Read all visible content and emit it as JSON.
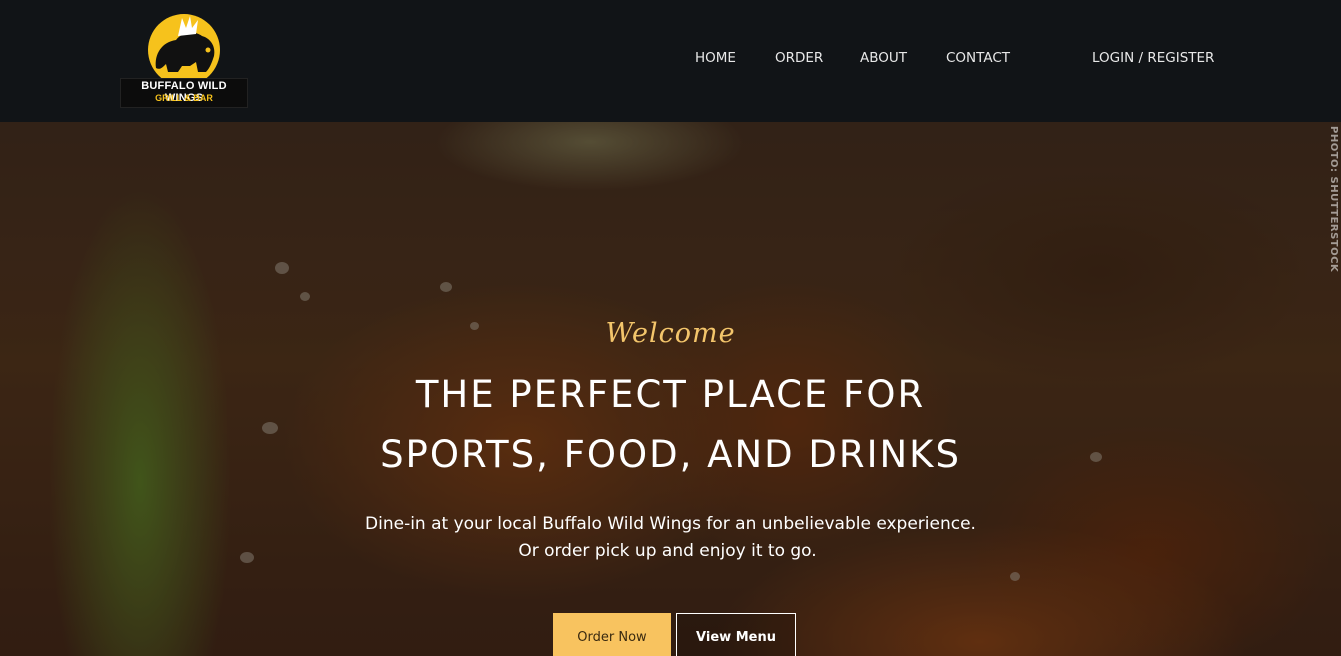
{
  "brand": {
    "name": "BUFFALO WILD WINGS",
    "tagline": "GRILL & BAR",
    "colors": {
      "yellow": "#f6c21c",
      "black": "#0c0c0c"
    }
  },
  "nav": {
    "home": "HOME",
    "order": "ORDER",
    "about": "ABOUT",
    "contact": "CONTACT",
    "login": "LOGIN / REGISTER"
  },
  "hero": {
    "welcome": "Welcome",
    "headline_line1": "THE PERFECT PLACE FOR",
    "headline_line2": "SPORTS, FOOD, AND DRINKS",
    "subtext_line1": "Dine-in at your local Buffalo Wild Wings for an unbelievable experience.",
    "subtext_line2": "Or order pick up and enjoy it to go.",
    "photo_credit": "PHOTO: SHUTTERSTOCK",
    "primary_button": "Order Now",
    "secondary_button": "View Menu",
    "accent_color": "#f8c35f"
  }
}
